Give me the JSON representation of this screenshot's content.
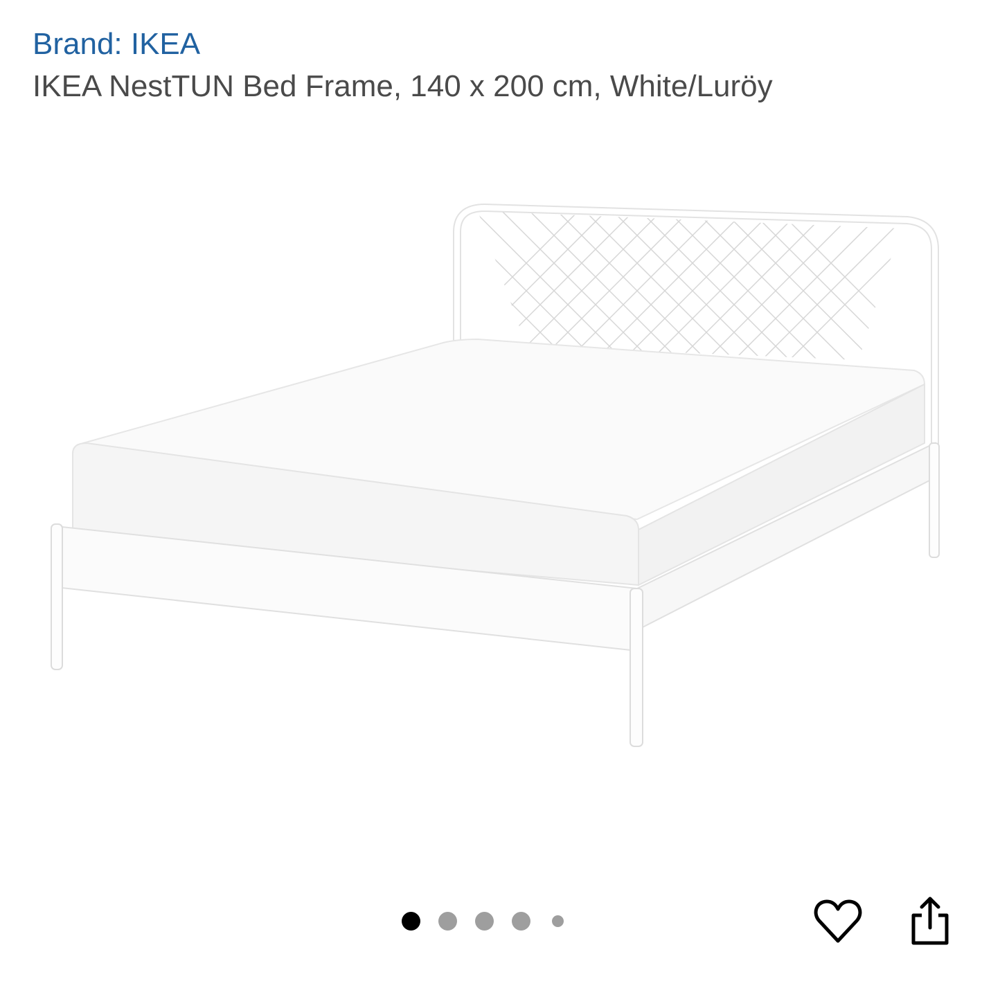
{
  "product": {
    "brand_label": "Brand: IKEA",
    "title": "IKEA NestTUN Bed Frame, 140 x 200 cm, White/Luröy"
  },
  "gallery": {
    "image_name": "white-metal-bed-frame-with-mattress",
    "total_images": 5,
    "current_index": 1
  },
  "actions": {
    "wishlist_icon": "heart-icon",
    "share_icon": "share-icon"
  },
  "colors": {
    "brand_link": "#2162a1",
    "title_text": "#4a4a4a",
    "dot_active": "#000000",
    "dot_inactive": "#9e9e9e"
  }
}
